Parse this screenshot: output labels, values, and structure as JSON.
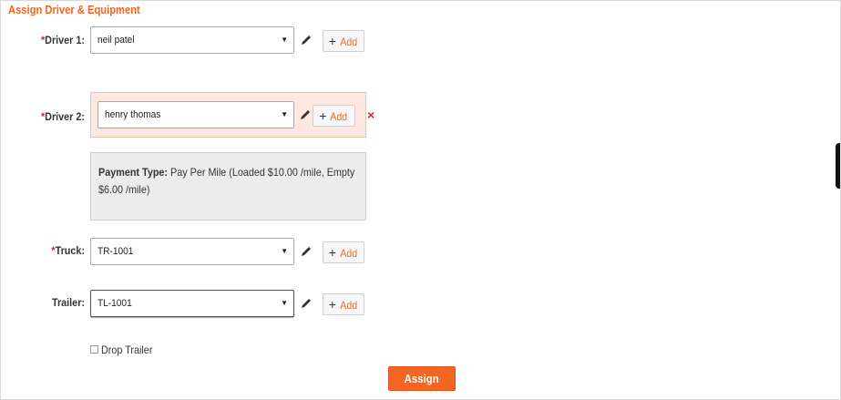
{
  "section_title": "Assign Driver & Equipment",
  "required_marker": "*",
  "driver1": {
    "label": "Driver 1:",
    "value": "neil patel",
    "add_label": "Add"
  },
  "driver2": {
    "label": "Driver 2:",
    "value": "henry thomas",
    "add_label": "Add",
    "remove_icon": "×"
  },
  "payment": {
    "label": "Payment Type:",
    "text": " Pay Per Mile (Loaded $10.00 /mile, Empty $6.00 /mile)"
  },
  "truck": {
    "label": "Truck:",
    "value": "TR-1001",
    "add_label": "Add"
  },
  "trailer": {
    "label": "Trailer:",
    "value": "TL-1001",
    "add_label": "Add"
  },
  "drop_trailer_label": "Drop Trailer",
  "assign_label": "Assign",
  "colors": {
    "accent": "#f26522",
    "required": "#e2231a",
    "highlight_bg": "#fde8df"
  },
  "icons": {
    "caret": "▼",
    "plus": "+"
  }
}
